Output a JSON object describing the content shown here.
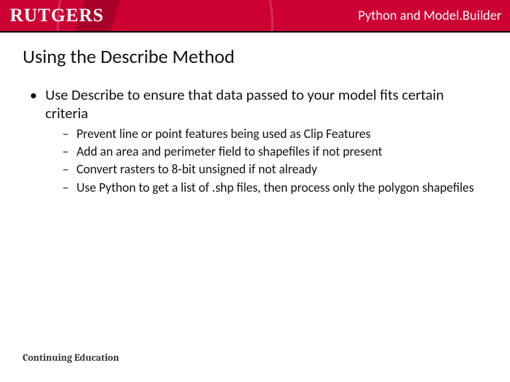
{
  "header": {
    "logo": "RUTGERS",
    "subject": "Python and Model.Builder"
  },
  "title": "Using the Describe Method",
  "points": [
    {
      "text": "Use Describe to ensure that data passed to your model fits certain criteria",
      "sub": [
        "Prevent line or point features being used as Clip Features",
        "Add an area and perimeter field to shapefiles if not present",
        "Convert rasters to 8-bit unsigned if not already",
        "Use Python to get a list of .shp files, then process only the polygon shapefiles"
      ]
    }
  ],
  "footer": "Continuing Education"
}
